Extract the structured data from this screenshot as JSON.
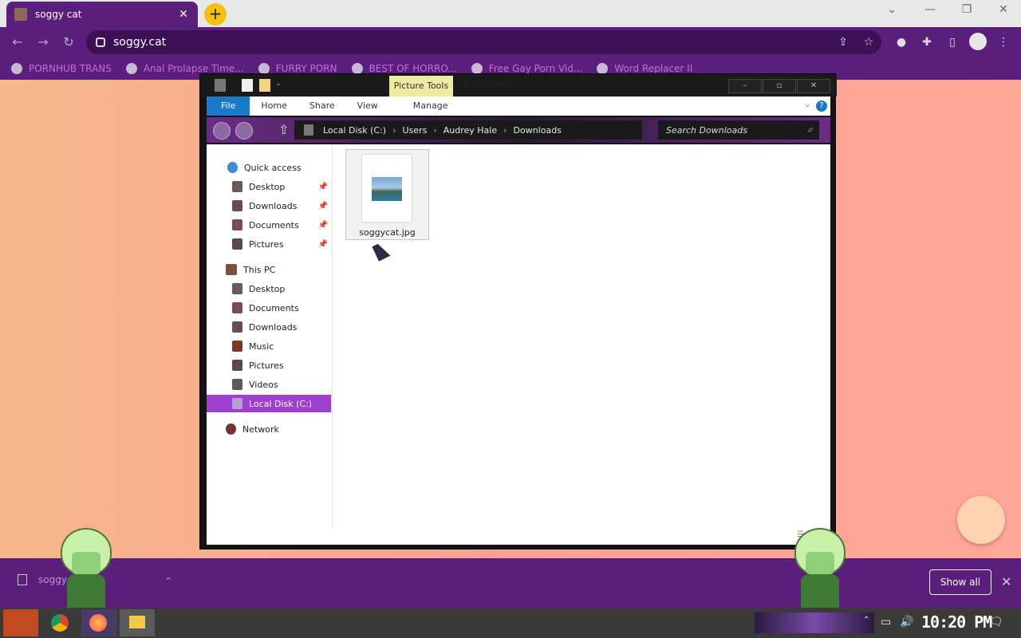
{
  "browser": {
    "tab_title": "soggy cat",
    "tab_close": "✕",
    "new_tab": "+",
    "url": "soggy.cat",
    "window_controls": {
      "minimize": "—",
      "restore": "❐",
      "close": "✕"
    },
    "chevron": "⌄"
  },
  "bookmarks": [
    {
      "label": "PORNHUB TRANS"
    },
    {
      "label": "Anal Prolapse Time..."
    },
    {
      "label": "FURRY PORN"
    },
    {
      "label": "BEST OF HORRO..."
    },
    {
      "label": "Free Gay Porn Vid..."
    },
    {
      "label": "Word Replacer II"
    }
  ],
  "explorer": {
    "contextual_tab": "Picture Tools",
    "title": "Downloads",
    "ribbon_tabs": [
      "File",
      "Home",
      "Share",
      "View",
      "Manage"
    ],
    "help": "?",
    "path": [
      "Local Disk (C:)",
      "Users",
      "Audrey Hale",
      "Downloads"
    ],
    "search_placeholder": "Search Downloads",
    "quick_access": "Quick access",
    "quick_items": [
      "Desktop",
      "Downloads",
      "Documents",
      "Pictures"
    ],
    "this_pc": "This PC",
    "pc_items": [
      "Desktop",
      "Documents",
      "Downloads",
      "Music",
      "Pictures",
      "Videos"
    ],
    "local_disk": "Local Disk (C:)",
    "network": "Network",
    "file_name": "soggycat.jpg"
  },
  "shelf": {
    "download_name": "soggycat",
    "show_all": "Show all"
  },
  "taskbar": {
    "clock": "10:20 PM"
  },
  "colors": {
    "browser_purple": "#5a1f7a",
    "selection": "#9d3fd0",
    "file_tab": "#1979ca",
    "picture_tools": "#f0eaa0"
  }
}
